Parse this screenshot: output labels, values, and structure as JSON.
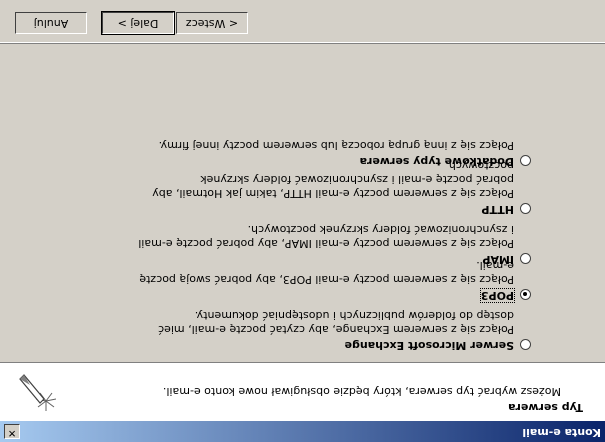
{
  "window": {
    "title": "Konta e-mail"
  },
  "header": {
    "title": "Typ serwera",
    "subtitle": "Możesz wybrać typ serwera, który będzie obsługiwał nowe konto e-mail."
  },
  "options": [
    {
      "label": "Serwer Microsoft Exchange",
      "description": "Połącz się z serwerem Exchange, aby czytać pocztę e-mail, mieć dostęp do folderów publicznych i udostępniać dokumenty.",
      "selected": false
    },
    {
      "label": "POP3",
      "description": "Połącz się z serwerem poczty e-mail POP3, aby pobrać swoją pocztę e-mail.",
      "selected": true
    },
    {
      "label": "IMAP",
      "description": "Połącz się z serwerem poczty e-mail IMAP, aby pobrać pocztę e-mail i zsynchronizować foldery skrzynek pocztowych.",
      "selected": false
    },
    {
      "label": "HTTP",
      "description": "Połącz się z serwerem poczty e-mail HTTP, takim jak Hotmail, aby pobrać pocztę e-mail i zsynchronizować foldery skrzynek pocztowych.",
      "selected": false
    },
    {
      "label": "Dodatkowe typy serwera",
      "description": "Połącz się z inną grupą roboczą lub serwerem poczty innej firmy.",
      "selected": false
    }
  ],
  "buttons": {
    "back": "< Wstecz",
    "next": "Dalej >",
    "cancel": "Anuluj"
  },
  "icons": {
    "close": "close-icon",
    "wizard": "wizard-wand-icon"
  }
}
